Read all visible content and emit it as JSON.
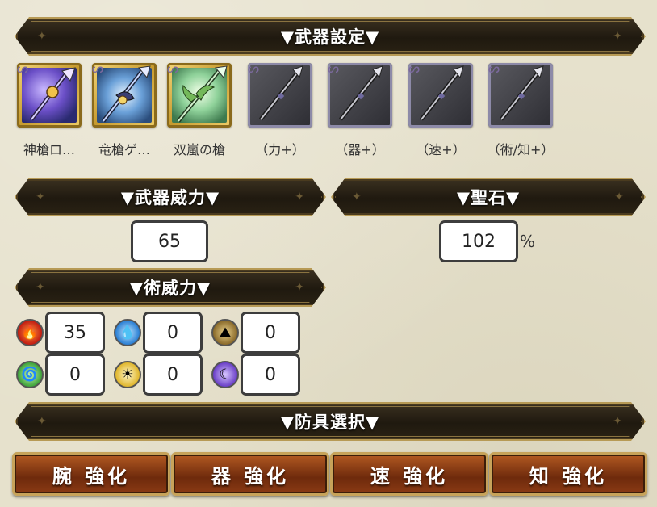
{
  "weapon_section": {
    "title": "▼武器設定▼",
    "slots": [
      {
        "label": "神槍ロ…",
        "icon": "divine-spear-icon",
        "style": "gold"
      },
      {
        "label": "竜槍ゲ…",
        "icon": "dragon-spear-icon",
        "style": "gold"
      },
      {
        "label": "双嵐の槍",
        "icon": "twin-storm-spear-icon",
        "style": "gold"
      },
      {
        "label": "（力+）",
        "icon": "spear-icon",
        "style": "dark"
      },
      {
        "label": "（器+）",
        "icon": "spear-icon",
        "style": "dark"
      },
      {
        "label": "（速+）",
        "icon": "spear-icon",
        "style": "dark"
      },
      {
        "label": "（術/知+）",
        "icon": "spear-icon",
        "style": "dark"
      }
    ]
  },
  "weapon_power": {
    "title": "▼武器威力▼",
    "value": "65"
  },
  "holy_stone": {
    "title": "▼聖石▼",
    "value": "102",
    "unit": "%"
  },
  "art_power": {
    "title": "▼術威力▼",
    "elements": [
      {
        "icon": "fire-icon",
        "value": "35"
      },
      {
        "icon": "water-icon",
        "value": "0"
      },
      {
        "icon": "earth-icon",
        "value": "0"
      },
      {
        "icon": "wind-icon",
        "value": "0"
      },
      {
        "icon": "light-icon",
        "value": "0"
      },
      {
        "icon": "dark-icon",
        "value": "0"
      }
    ]
  },
  "armor_section": {
    "title": "▼防具選択▼",
    "buttons": [
      "腕 強化",
      "器 強化",
      "速 強化",
      "知 強化"
    ]
  },
  "colors": {
    "banner_bg": "#1f190f",
    "banner_border": "#b79a55",
    "button_bg": "#8a3a14",
    "page_bg": "#e6e1cc"
  }
}
